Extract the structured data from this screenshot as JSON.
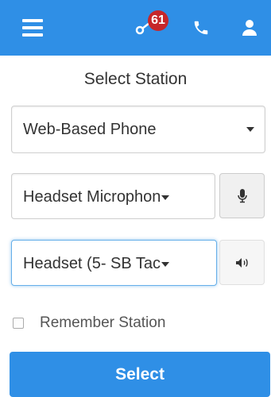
{
  "colors": {
    "accent": "#2f8fe6",
    "badge": "#c6272b"
  },
  "topbar": {
    "menu_icon": "hamburger-icon",
    "notifications": {
      "icon": "key-icon",
      "badge_count": "61"
    },
    "phone_icon": "phone-icon",
    "user_icon": "user-icon"
  },
  "title": "Select Station",
  "station_select": {
    "value": "Web-Based Phone"
  },
  "microphone": {
    "value": "Headset Microphon",
    "button_icon": "microphone-icon"
  },
  "speaker": {
    "value": "Headset (5- SB Tac",
    "button_icon": "speaker-icon"
  },
  "remember": {
    "label": "Remember Station",
    "checked": false
  },
  "submit": {
    "label": "Select"
  }
}
